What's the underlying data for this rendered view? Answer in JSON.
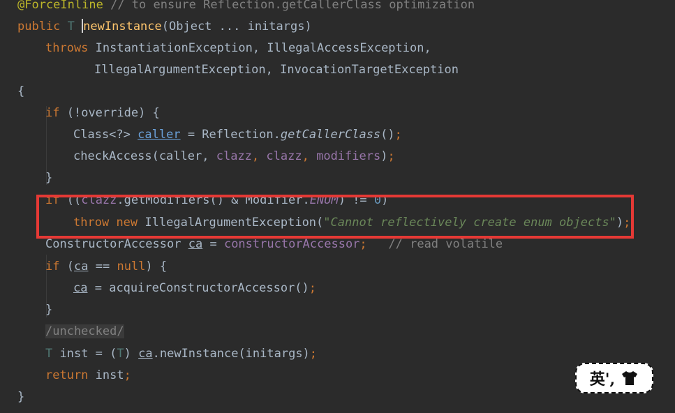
{
  "code": {
    "annotation": "@ForceInline",
    "annotation_comment": "// to ensure Reflection.getCallerClass optimization",
    "kw_public": "public",
    "type_T": "T",
    "method_name": "newInstance",
    "params": "(Object ... initargs)",
    "kw_throws": "throws",
    "throws_1": "InstantiationException, IllegalAccessException,",
    "throws_2": "IllegalArgumentException, InvocationTargetException",
    "open_brace": "{",
    "kw_if": "if",
    "if_cond_1": "(!override) {",
    "class_generic": "Class<?>",
    "caller": "caller",
    "reflection_call": "= Reflection.",
    "get_caller_class": "getCallerClass",
    "call_parens": "()",
    "semicolon": ";",
    "check_access": "checkAccess(caller,",
    "clazz": "clazz",
    "comma": ",",
    "modifiers": "modifiers",
    "close_paren": ")",
    "close_brace": "}",
    "enum_cond_open": "((",
    "get_modifiers": ".getModifiers() & Modifier.",
    "enum_const": "ENUM",
    "neq": ") != ",
    "zero": "0",
    "kw_throw": "throw",
    "kw_new": "new",
    "exception_class": "IllegalArgumentException(",
    "exception_msg": "\"Cannot reflectively create enum objects\"",
    "ctor_accessor_type": "ConstructorAccessor",
    "ca": "ca",
    "assign": "=",
    "ctor_accessor_field": "constructorAccessor",
    "read_volatile_comment": "// read volatile",
    "null_cond_open": "(",
    "eq": "==",
    "kw_null": "null",
    "null_cond_close": ") {",
    "acquire": "= acquireConstructorAccessor()",
    "unchecked": "/unchecked/",
    "inst_decl": "inst = (",
    "cast_close": ")",
    "new_instance_call": ".newInstance(initargs)",
    "kw_return": "return",
    "return_val": "inst"
  },
  "sticker": {
    "text": "英',",
    "icon": "tshirt-icon"
  },
  "colors": {
    "background": "#2b2b2b",
    "highlight_box": "#e53935"
  }
}
